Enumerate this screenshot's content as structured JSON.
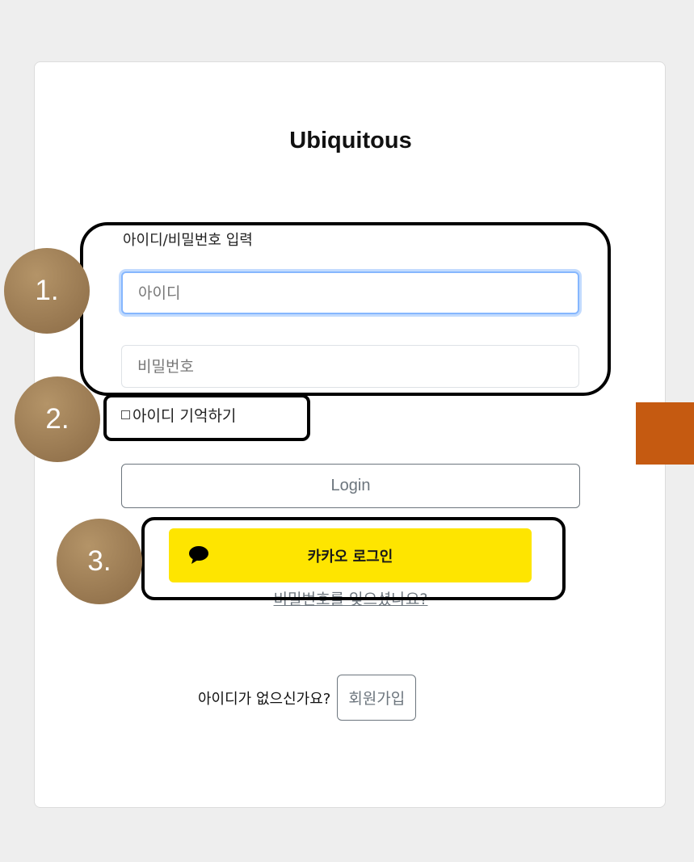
{
  "app": {
    "title": "Ubiquitous"
  },
  "login_form": {
    "section_label": "아이디/비밀번호 입력",
    "id_input": {
      "placeholder": "아이디",
      "value": ""
    },
    "password_input": {
      "placeholder": "비밀번호",
      "value": ""
    },
    "remember_id": {
      "checked": false,
      "label": "아이디 기억하기"
    },
    "login_button_label": "Login",
    "kakao_button": {
      "label": "카카오 로그인",
      "icon": "speech-bubble-icon",
      "color": "#FEE500"
    },
    "forgot_password_link": "비밀번호를 잊으셨나요?"
  },
  "signup": {
    "prompt": "아이디가 없으신가요?",
    "button_label": "회원가입"
  },
  "annotations": {
    "markers": [
      "1.",
      "2.",
      "3."
    ],
    "marker_color": "#9c7b55",
    "side_block_color": "#C55A11"
  }
}
